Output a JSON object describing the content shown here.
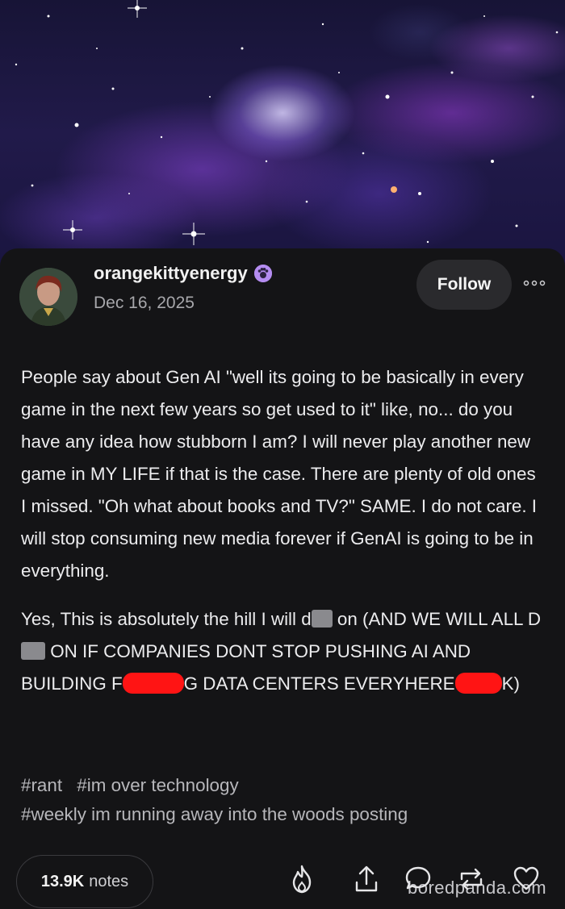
{
  "post": {
    "username": "orangekittyenergy",
    "date": "Dec 16, 2025",
    "follow_label": "Follow",
    "paragraph1": "People say about Gen AI \"well its going to be basically in every game in the next few years so get used to it\" like, no... do you have any idea how stubborn I am? I will never play another new game in MY LIFE if that is the case. There are plenty of old ones I missed. \"Oh what about books and TV?\" SAME. I do not care. I will stop consuming new media forever if GenAI is going to be in everything.",
    "p2_part1": "Yes, This is absolutely the hill I will d",
    "p2_part2": " on (AND WE WILL ALL D",
    "p2_part3": " ON IF COMPANIES DONT STOP PUSHING AI AND BUILDING F",
    "p2_part4": "G DATA CENTERS EVERYHERE",
    "p2_part5": "K)",
    "tags": [
      "#rant",
      "#im over technology",
      "#weekly im running away into the woods posting"
    ],
    "notes_count": "13.9K",
    "notes_label": "notes",
    "watermark": "boredpanda.com"
  },
  "icons": {
    "badge": "paw-badge-icon",
    "more": "more-options-icon",
    "actions": [
      "fire-icon",
      "share-icon",
      "comment-icon",
      "reblog-icon",
      "heart-icon"
    ]
  },
  "colors": {
    "card_background": "#141416",
    "censor_red": "#ff1414",
    "badge_purple": "#b48cf0"
  }
}
